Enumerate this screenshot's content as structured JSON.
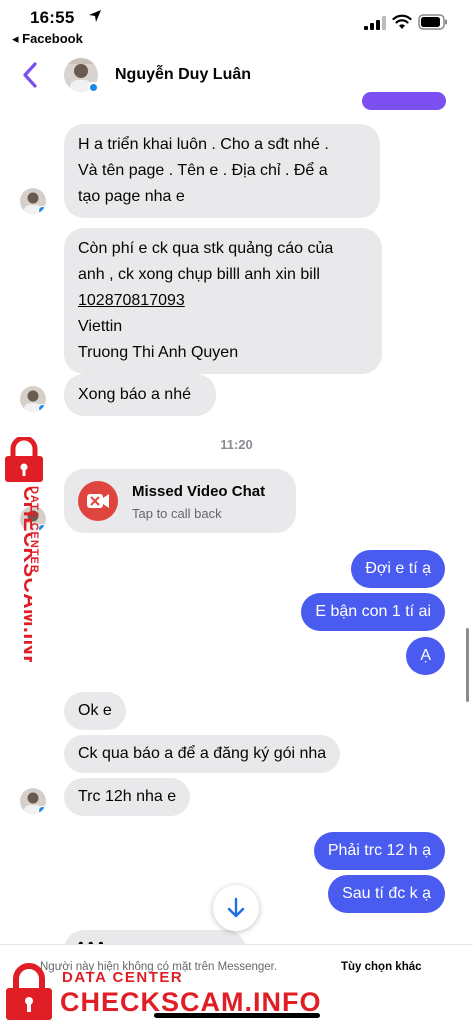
{
  "status_bar": {
    "time": "16:55",
    "back_app": "◂ Facebook"
  },
  "header": {
    "contact_name": "Nguyễn Duy Luân",
    "accent_color": "#7b4ff0"
  },
  "messages": {
    "in_1_lines": [
      "H a triển khai luôn . Cho a sđt nhé .",
      "Và tên page . Tên e . Địa chỉ . Để a",
      "tạo page nha e"
    ],
    "in_2_lines": [
      "Còn phí e ck qua stk quảng cáo của",
      "anh , ck xong chụp billl anh xin bill"
    ],
    "in_2_account": "102870817093",
    "in_2_bank": "Viettin",
    "in_2_holder": "Truong Thi Anh Quyen",
    "in_3": "Xong báo a nhé",
    "timestamp": "11:20",
    "missed_call_title": "Missed Video Chat",
    "missed_call_sub": "Tap to call back",
    "out_1": "Đợi e tí ạ",
    "out_2": "E bận con 1 tí ai",
    "out_3": "Ạ",
    "in_4": "Ok e",
    "in_5": "Ck qua báo a để a đăng ký gói nha",
    "in_6": "Trc 12h nha e",
    "out_4": "Phải trc 12 h ạ",
    "out_5": "Sau tí đc k ạ",
    "partial": "• • •"
  },
  "footer": {
    "notice": "Người này hiện không có mặt trên Messenger.",
    "options_link": "Tùy chọn khác"
  },
  "watermark": {
    "main": "CHECKSCAM.INFO",
    "sub": "DATA CENTER",
    "color": "#e01e26"
  }
}
